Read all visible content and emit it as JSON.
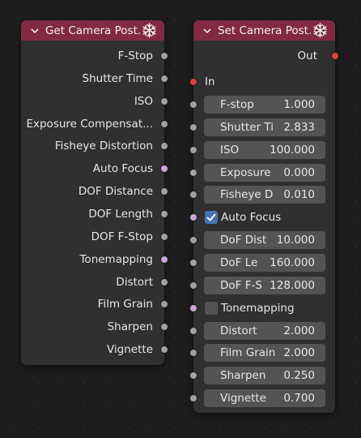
{
  "get_node": {
    "title": "Get Camera Post.",
    "outputs": [
      {
        "label": "F-Stop",
        "type": "grey"
      },
      {
        "label": "Shutter Time",
        "type": "grey"
      },
      {
        "label": "ISO",
        "type": "grey"
      },
      {
        "label": "Exposure Compensat...",
        "type": "grey"
      },
      {
        "label": "Fisheye Distortion",
        "type": "grey"
      },
      {
        "label": "Auto Focus",
        "type": "pink"
      },
      {
        "label": "DOF Distance",
        "type": "grey"
      },
      {
        "label": "DOF Length",
        "type": "grey"
      },
      {
        "label": "DOF F-Stop",
        "type": "grey"
      },
      {
        "label": "Tonemapping",
        "type": "pink"
      },
      {
        "label": "Distort",
        "type": "grey"
      },
      {
        "label": "Film Grain",
        "type": "grey"
      },
      {
        "label": "Sharpen",
        "type": "grey"
      },
      {
        "label": "Vignette",
        "type": "grey"
      }
    ]
  },
  "set_node": {
    "title": "Set Camera Post.",
    "out_label": "Out",
    "in_label": "In",
    "inputs": [
      {
        "kind": "field",
        "label": "F-stop",
        "value": "1.000"
      },
      {
        "kind": "field",
        "label": "Shutter Ti",
        "value": "2.833"
      },
      {
        "kind": "field",
        "label": "ISO",
        "value": "100.000"
      },
      {
        "kind": "field",
        "label": "Exposure",
        "value": "0.000"
      },
      {
        "kind": "field",
        "label": "Fisheye D",
        "value": "0.010"
      },
      {
        "kind": "checkbox",
        "label": "Auto Focus",
        "checked": true
      },
      {
        "kind": "field",
        "label": "DoF Dist",
        "value": "10.000"
      },
      {
        "kind": "field",
        "label": "DoF Le",
        "value": "160.000"
      },
      {
        "kind": "field",
        "label": "DoF F-S",
        "value": "128.000"
      },
      {
        "kind": "checkbox",
        "label": "Tonemapping",
        "checked": false
      },
      {
        "kind": "field",
        "label": "Distort",
        "value": "2.000"
      },
      {
        "kind": "field",
        "label": "Film Grain",
        "value": "2.000"
      },
      {
        "kind": "field",
        "label": "Sharpen",
        "value": "0.250"
      },
      {
        "kind": "field",
        "label": "Vignette",
        "value": "0.700"
      }
    ]
  },
  "icons": {
    "collapse": "chevron-down-icon",
    "node_type": "snowflake-icon"
  },
  "colors": {
    "header": "#822a44",
    "node_body": "#303030",
    "socket_float": "#a1a1a1",
    "socket_bool": "#cca6d6",
    "socket_exec": "#d93f3f",
    "checkbox_checked": "#4772b3"
  }
}
